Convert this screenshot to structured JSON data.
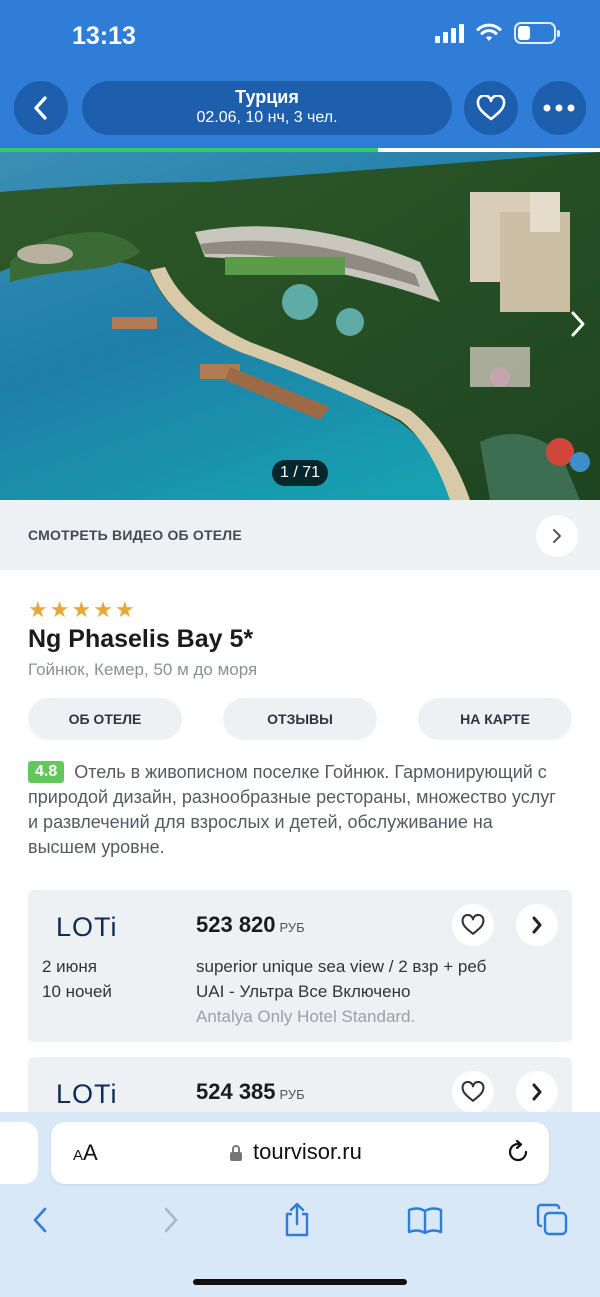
{
  "status_bar": {
    "time": "13:13",
    "battery_level": 0.35
  },
  "header": {
    "title": "Турция",
    "subtitle": "02.06, 10 нч, 3 чел.",
    "progress_fraction": 0.63
  },
  "gallery": {
    "counter": "1 / 71"
  },
  "video": {
    "label": "СМОТРЕТЬ ВИДЕО ОБ ОТЕЛЕ"
  },
  "hotel": {
    "stars": 5,
    "name": "Ng Phaselis Bay 5*",
    "location": "Гойнюк, Кемер, 50 м до моря",
    "rating": "4.8",
    "description": "Отель в живописном поселке Гойнюк. Гармонирующий с природой дизайн, разнообразные рестораны, множество услуг и развлечений для взрослых и детей, обслуживание на высшем уровне."
  },
  "tabs": [
    "ОБ ОТЕЛЕ",
    "ОТЗЫВЫ",
    "НА КАРТЕ"
  ],
  "offers": [
    {
      "operator": "LOTi",
      "price": "523 820",
      "currency": "РУБ",
      "date": "2 июня",
      "nights": "10 ночей",
      "room": "superior unique sea view / 2 взр + реб",
      "meal": "UAI - Ультра Все Включено",
      "operator_note": "Antalya Only Hotel Standard."
    },
    {
      "operator": "LOTi",
      "price": "524 385",
      "currency": "РУБ"
    }
  ],
  "browser": {
    "text_size_label_small": "A",
    "text_size_label_large": "A",
    "url": "tourvisor.ru"
  },
  "colors": {
    "header_blue": "#2f7dd6",
    "header_control": "#1d5fad",
    "progress_green": "#2fcf5c",
    "rating_green": "#63c75b",
    "star_gold": "#e5a93a",
    "safari_bar": "#d8e8f7"
  },
  "icons": [
    "back-arrow-icon",
    "heart-icon",
    "more-dots-icon",
    "chevron-right-icon",
    "lock-icon",
    "reload-icon",
    "share-icon",
    "bookmarks-icon",
    "tabs-icon"
  ]
}
